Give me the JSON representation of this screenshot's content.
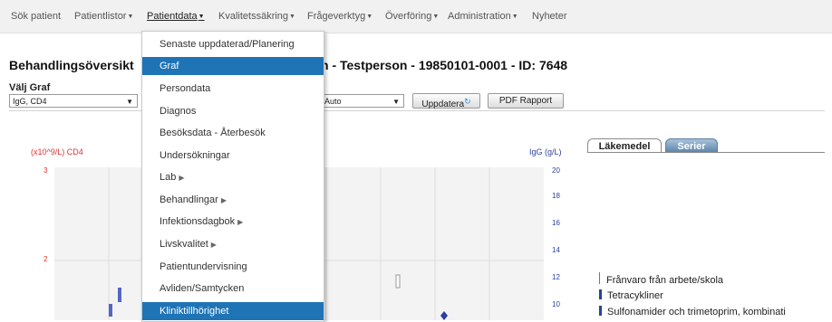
{
  "nav": [
    {
      "label": "Sök patient",
      "dropdown": false
    },
    {
      "label": "Patientlistor",
      "dropdown": true
    },
    {
      "label": "Patientdata",
      "dropdown": true
    },
    {
      "label": "Kvalitetssäkring",
      "dropdown": true
    },
    {
      "label": "Frågeverktyg",
      "dropdown": true
    },
    {
      "label": "Överföring",
      "dropdown": true
    },
    {
      "label": "Administration",
      "dropdown": true
    },
    {
      "label": "Nyheter",
      "dropdown": false
    }
  ],
  "nav_active": "Patientdata",
  "page": {
    "title_left": "Behandlingsöversikt",
    "title_right": "n - Testperson - 19850101-0001 - ID: 7648"
  },
  "graph_controls": {
    "label": "Välj Graf",
    "graph_select": "IgG, CD4",
    "scale_select": "Auto",
    "update_button": "Uppdatera",
    "pdf_button": "PDF Rapport"
  },
  "chart_data": {
    "type": "bar",
    "y_left": {
      "label": "(x10^9/L) CD4",
      "ticks": [
        "3",
        "2"
      ],
      "color": "#e03030"
    },
    "y_right": {
      "label": "IgG (g/L)",
      "ticks": [
        "20",
        "18",
        "16",
        "14",
        "12",
        "10"
      ],
      "color": "#2b3f9e"
    }
  },
  "panel": {
    "tabs": [
      "Läkemedel",
      "Serier"
    ],
    "legend": [
      "Frånvaro från arbete/skola",
      "Tetracykliner",
      "Sulfonamider och trimetoprim, kombinati"
    ]
  },
  "menu": {
    "items": [
      {
        "label": "Senaste uppdaterad/Planering",
        "sub": false
      },
      {
        "label": "Graf",
        "sub": false
      },
      {
        "label": "Persondata",
        "sub": false
      },
      {
        "label": "Diagnos",
        "sub": false
      },
      {
        "label": "Besöksdata - Återbesök",
        "sub": false
      },
      {
        "label": "Undersökningar",
        "sub": false
      },
      {
        "label": "Lab",
        "sub": true
      },
      {
        "label": "Behandlingar",
        "sub": true
      },
      {
        "label": "Infektionsdagbok",
        "sub": true
      },
      {
        "label": "Livskvalitet",
        "sub": true
      },
      {
        "label": "Patientundervisning",
        "sub": false
      },
      {
        "label": "Avliden/Samtycken",
        "sub": false
      },
      {
        "label": "Kliniktillhörighet",
        "sub": false
      }
    ],
    "selected": [
      "Graf",
      "Kliniktillhörighet"
    ]
  },
  "colors": {
    "menu_highlight": "#1f74b6",
    "series_bar": "#2b3f9e",
    "axis_left": "#e03030"
  }
}
